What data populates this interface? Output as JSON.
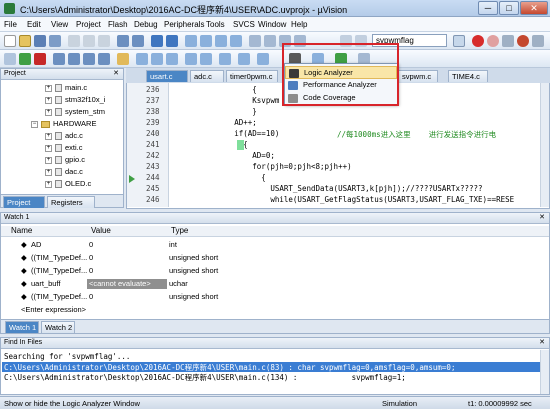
{
  "window": {
    "title": "C:\\Users\\Administrator\\Desktop\\2016AC-DC程序新4\\USER\\ADC.uvprojx - µVision",
    "min": "─",
    "max": "□",
    "close": "✕"
  },
  "menu": [
    "File",
    "Edit",
    "View",
    "Project",
    "Flash",
    "Debug",
    "Peripherals",
    "Tools",
    "SVCS",
    "Window",
    "Help"
  ],
  "toolbar": {
    "search_value": "svpwmflag"
  },
  "project": {
    "title": "Project",
    "close": "✕",
    "items": [
      {
        "label": "main.c",
        "kind": "file"
      },
      {
        "label": "stm32f10x_i",
        "kind": "file"
      },
      {
        "label": "system_stm",
        "kind": "file"
      },
      {
        "label": "HARDWARE",
        "kind": "folder"
      },
      {
        "label": "adc.c",
        "kind": "file"
      },
      {
        "label": "exti.c",
        "kind": "file"
      },
      {
        "label": "gpio.c",
        "kind": "file"
      },
      {
        "label": "dac.c",
        "kind": "file"
      },
      {
        "label": "OLED.c",
        "kind": "file"
      }
    ],
    "tabs": [
      "Project",
      "Registers"
    ]
  },
  "editor": {
    "tabs": [
      "usart.c",
      "adc.c",
      "timer0pwm.c",
      "svpwm.c",
      "TIME4.c"
    ],
    "lines": [
      {
        "no": "236",
        "text": "                  {"
      },
      {
        "no": "237",
        "text": "                  Ksvpwm"
      },
      {
        "no": "238",
        "text": "                  }"
      },
      {
        "no": "239",
        "text": "              AD++;"
      },
      {
        "no": "240",
        "text": "              if(AD==10)"
      },
      {
        "no": "241",
        "text": "                {"
      },
      {
        "no": "242",
        "text": "                  AD=0;"
      },
      {
        "no": "243",
        "text": "                  for(pjh=0;pjh<8;pjh++)"
      },
      {
        "no": "244",
        "text": "                    {"
      },
      {
        "no": "245",
        "text": "                      USART_SendData(USART3,k[pjh]);//????USARTx?????"
      },
      {
        "no": "246",
        "text": "                      while(USART_GetFlagStatus(USART3,USART_FLAG_TXE)==RESE"
      }
    ],
    "comment_240": "//每1000ms进入这里    进行发送指令进行电"
  },
  "analysis_menu": {
    "items": [
      "Logic Analyzer",
      "Performance Analyzer",
      "Code Coverage"
    ]
  },
  "watch": {
    "title": "Watch 1",
    "close": "✕",
    "columns": [
      "Name",
      "Value",
      "Type"
    ],
    "rows": [
      {
        "name": "AD",
        "value": "0",
        "type": "int"
      },
      {
        "name": "((TIM_TypeDef...",
        "value": "0",
        "type": "unsigned short"
      },
      {
        "name": "((TIM_TypeDef...",
        "value": "0",
        "type": "unsigned short"
      },
      {
        "name": "uart_buff",
        "value": "<cannot evaluate>",
        "type": "uchar"
      },
      {
        "name": "((TIM_TypeDef...",
        "value": "0",
        "type": "unsigned short"
      },
      {
        "name": "<Enter expression>",
        "value": "",
        "type": ""
      }
    ],
    "tabs": [
      "Watch 1",
      "Watch 2"
    ]
  },
  "find": {
    "title": "Find In Files",
    "close": "✕",
    "lines": [
      "Searching for 'svpwmflag'...",
      "C:\\Users\\Administrator\\Desktop\\2016AC-DC程序新4\\USER\\main.c(83) : char svpwmflag=0,amsflag=0,amsum=0;",
      "C:\\Users\\Administrator\\Desktop\\2016AC-DC程序新4\\USER\\main.c(134) :            svpwmflag=1;"
    ]
  },
  "status": {
    "message": "Show or hide the Logic Analyzer Window",
    "mode": "Simulation",
    "time": "t1: 0.00009992 sec"
  }
}
